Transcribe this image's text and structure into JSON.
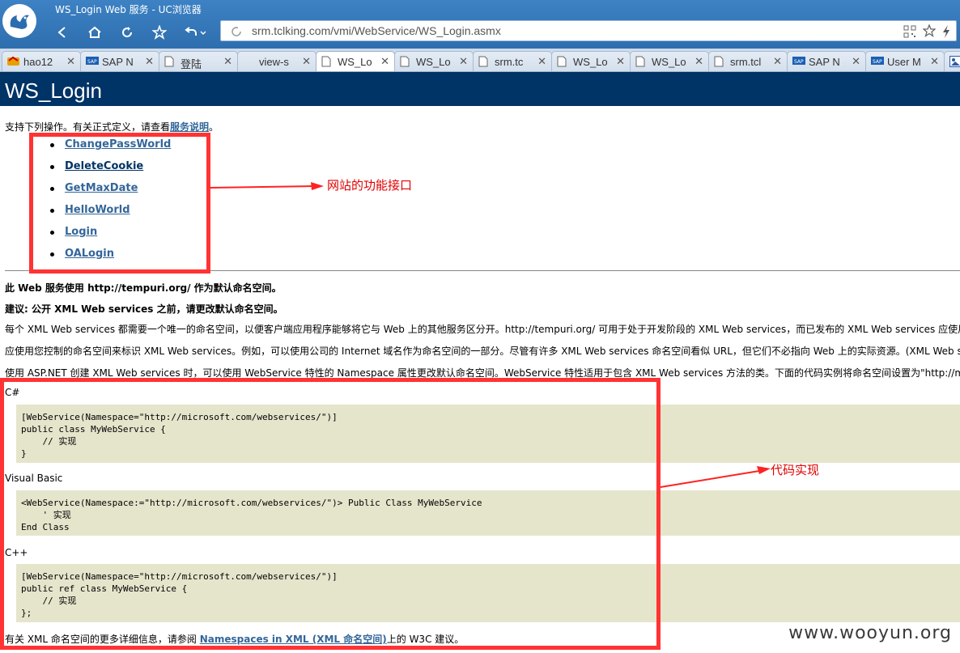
{
  "window": {
    "title": "WS_Login Web 服务 - UC浏览器"
  },
  "address_bar": {
    "url": "srm.tclking.com/vmi/WebService/WS_Login.asmx"
  },
  "tabs": [
    {
      "label": "hao12",
      "icon": "hao123-icon",
      "active": false
    },
    {
      "label": "SAP N",
      "icon": "sap-icon",
      "active": false
    },
    {
      "label": "登陆",
      "icon": "page-icon",
      "active": false
    },
    {
      "label": "view-s",
      "icon": "blank-icon",
      "active": false
    },
    {
      "label": "WS_Lo",
      "icon": "page-icon",
      "active": true
    },
    {
      "label": "WS_Lo",
      "icon": "page-icon",
      "active": false
    },
    {
      "label": "srm.tc",
      "icon": "page-icon",
      "active": false
    },
    {
      "label": "WS_Lo",
      "icon": "page-icon",
      "active": false
    },
    {
      "label": "WS_Lo",
      "icon": "page-icon",
      "active": false
    },
    {
      "label": "srm.tcl",
      "icon": "page-icon",
      "active": false
    },
    {
      "label": "SAP N",
      "icon": "sap-icon",
      "active": false
    },
    {
      "label": "User M",
      "icon": "sap-icon",
      "active": false
    }
  ],
  "page": {
    "heading": "WS_Login",
    "intro_prefix": "支持下列操作。有关正式定义，请查看",
    "intro_link": "服务说明",
    "intro_suffix": "。",
    "operations": [
      "ChangePassWorld",
      "DeleteCookie",
      "GetMaxDate",
      "HelloWorld",
      "Login",
      "OALogin"
    ],
    "namespace_notice": "此 Web 服务使用 http://tempuri.org/ 作为默认命名空间。",
    "recommendation": "建议: 公开 XML Web services 之前，请更改默认命名空间。",
    "para1": "每个 XML Web services 都需要一个唯一的命名空间，以便客户端应用程序能够将它与 Web 上的其他服务区分开。http://tempuri.org/ 可用于处于开发阶段的 XML Web services，而已发布的 XML Web services 应使用",
    "para2": "应使用您控制的命名空间来标识 XML Web services。例如，可以使用公司的 Internet 域名作为命名空间的一部分。尽管有许多 XML Web services 命名空间看似 URL，但它们不必指向 Web 上的实际资源。(XML Web s",
    "para3": "使用 ASP.NET 创建 XML Web services 时，可以使用 WebService 特性的 Namespace 属性更改默认命名空间。WebService 特性适用于包含 XML Web services 方法的类。下面的代码实例将命名空间设置为\"http://m",
    "lang_csharp": "C#",
    "code_csharp": "[WebService(Namespace=\"http://microsoft.com/webservices/\")]\npublic class MyWebService {\n    // 实现\n}",
    "lang_vb": "Visual Basic",
    "code_vb": "<WebService(Namespace:=\"http://microsoft.com/webservices/\")> Public Class MyWebService\n    ' 实现\nEnd Class",
    "lang_cpp": "C++",
    "code_cpp": "[WebService(Namespace=\"http://microsoft.com/webservices/\")]\npublic ref class MyWebService {\n    // 实现\n};",
    "footer_prefix": "有关 XML 命名空间的更多详细信息，请参阅",
    "footer_link": "Namespaces in XML (XML 命名空间)",
    "footer_suffix": "上的 W3C 建议。"
  },
  "annotations": {
    "interfaces_label": "网站的功能接口",
    "code_label": "代码实现",
    "color": "#ff3333"
  },
  "watermark": "www.wooyun.org"
}
